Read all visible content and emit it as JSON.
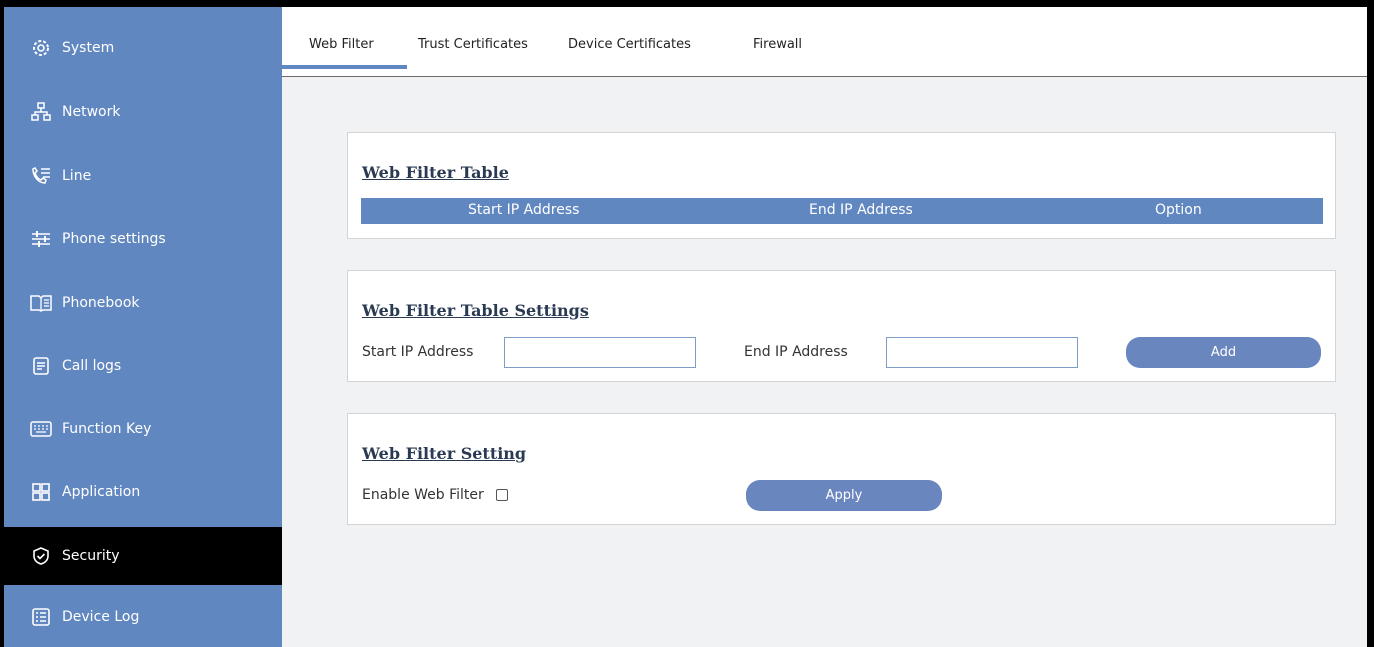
{
  "sidebar": {
    "items": [
      {
        "label": "System",
        "icon": "gear-icon"
      },
      {
        "label": "Network",
        "icon": "network-icon"
      },
      {
        "label": "Line",
        "icon": "phone-line-icon"
      },
      {
        "label": "Phone settings",
        "icon": "sliders-icon"
      },
      {
        "label": "Phonebook",
        "icon": "book-icon"
      },
      {
        "label": "Call logs",
        "icon": "document-icon"
      },
      {
        "label": "Function Key",
        "icon": "keyboard-icon"
      },
      {
        "label": "Application",
        "icon": "grid-icon"
      },
      {
        "label": "Security",
        "icon": "shield-icon",
        "active": true
      },
      {
        "label": "Device Log",
        "icon": "list-icon"
      }
    ],
    "colors": {
      "background": "#6187c0",
      "active": "#000000"
    }
  },
  "tabs": [
    {
      "label": "Web Filter",
      "active": true
    },
    {
      "label": "Trust Certificates"
    },
    {
      "label": "Device Certificates"
    },
    {
      "label": "Firewall"
    }
  ],
  "web_filter_table": {
    "title": "Web Filter Table",
    "columns": [
      "Start IP Address",
      "End IP Address",
      "Option"
    ]
  },
  "web_filter_table_settings": {
    "title": "Web Filter Table Settings",
    "start_ip_label": "Start IP Address",
    "start_ip_value": "",
    "end_ip_label": "End IP Address",
    "end_ip_value": "",
    "add_label": "Add"
  },
  "web_filter_setting": {
    "title": "Web Filter Setting",
    "enable_label": "Enable Web Filter",
    "enabled": false,
    "apply_label": "Apply"
  }
}
